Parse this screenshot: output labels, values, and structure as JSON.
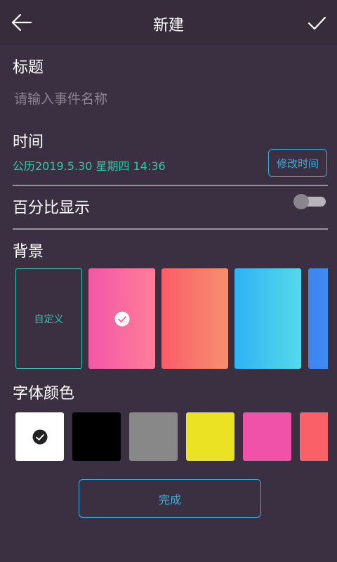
{
  "header": {
    "title": "新建",
    "back_icon": "back-arrow-icon",
    "confirm_icon": "checkmark-icon"
  },
  "title_section": {
    "label": "标题",
    "placeholder": "请输入事件名称",
    "value": ""
  },
  "time_section": {
    "label": "时间",
    "value": "公历2019.5.30 星期四 14:36",
    "edit_button": "修改时间"
  },
  "percent_section": {
    "label": "百分比显示",
    "enabled": false
  },
  "background_section": {
    "label": "背景",
    "custom_label": "自定义",
    "selected_index": 1,
    "options": [
      {
        "type": "custom"
      },
      {
        "type": "gradient",
        "from": "#f257a8",
        "to": "#ff7e98"
      },
      {
        "type": "gradient",
        "from": "#fa5c69",
        "to": "#f6906f"
      },
      {
        "type": "gradient",
        "from": "#2fb3f3",
        "to": "#56d9ea"
      },
      {
        "type": "gradient",
        "from": "#3b86f0",
        "to": "#4a9af3"
      }
    ]
  },
  "font_color_section": {
    "label": "字体颜色",
    "selected_index": 0,
    "colors": [
      "#ffffff",
      "#000000",
      "#888888",
      "#ebe223",
      "#f052a9",
      "#fa6068"
    ]
  },
  "done_button": "完成",
  "colors": {
    "background": "#3b3041",
    "accent_green": "#35c7ab",
    "accent_blue": "#3ab0e0"
  }
}
